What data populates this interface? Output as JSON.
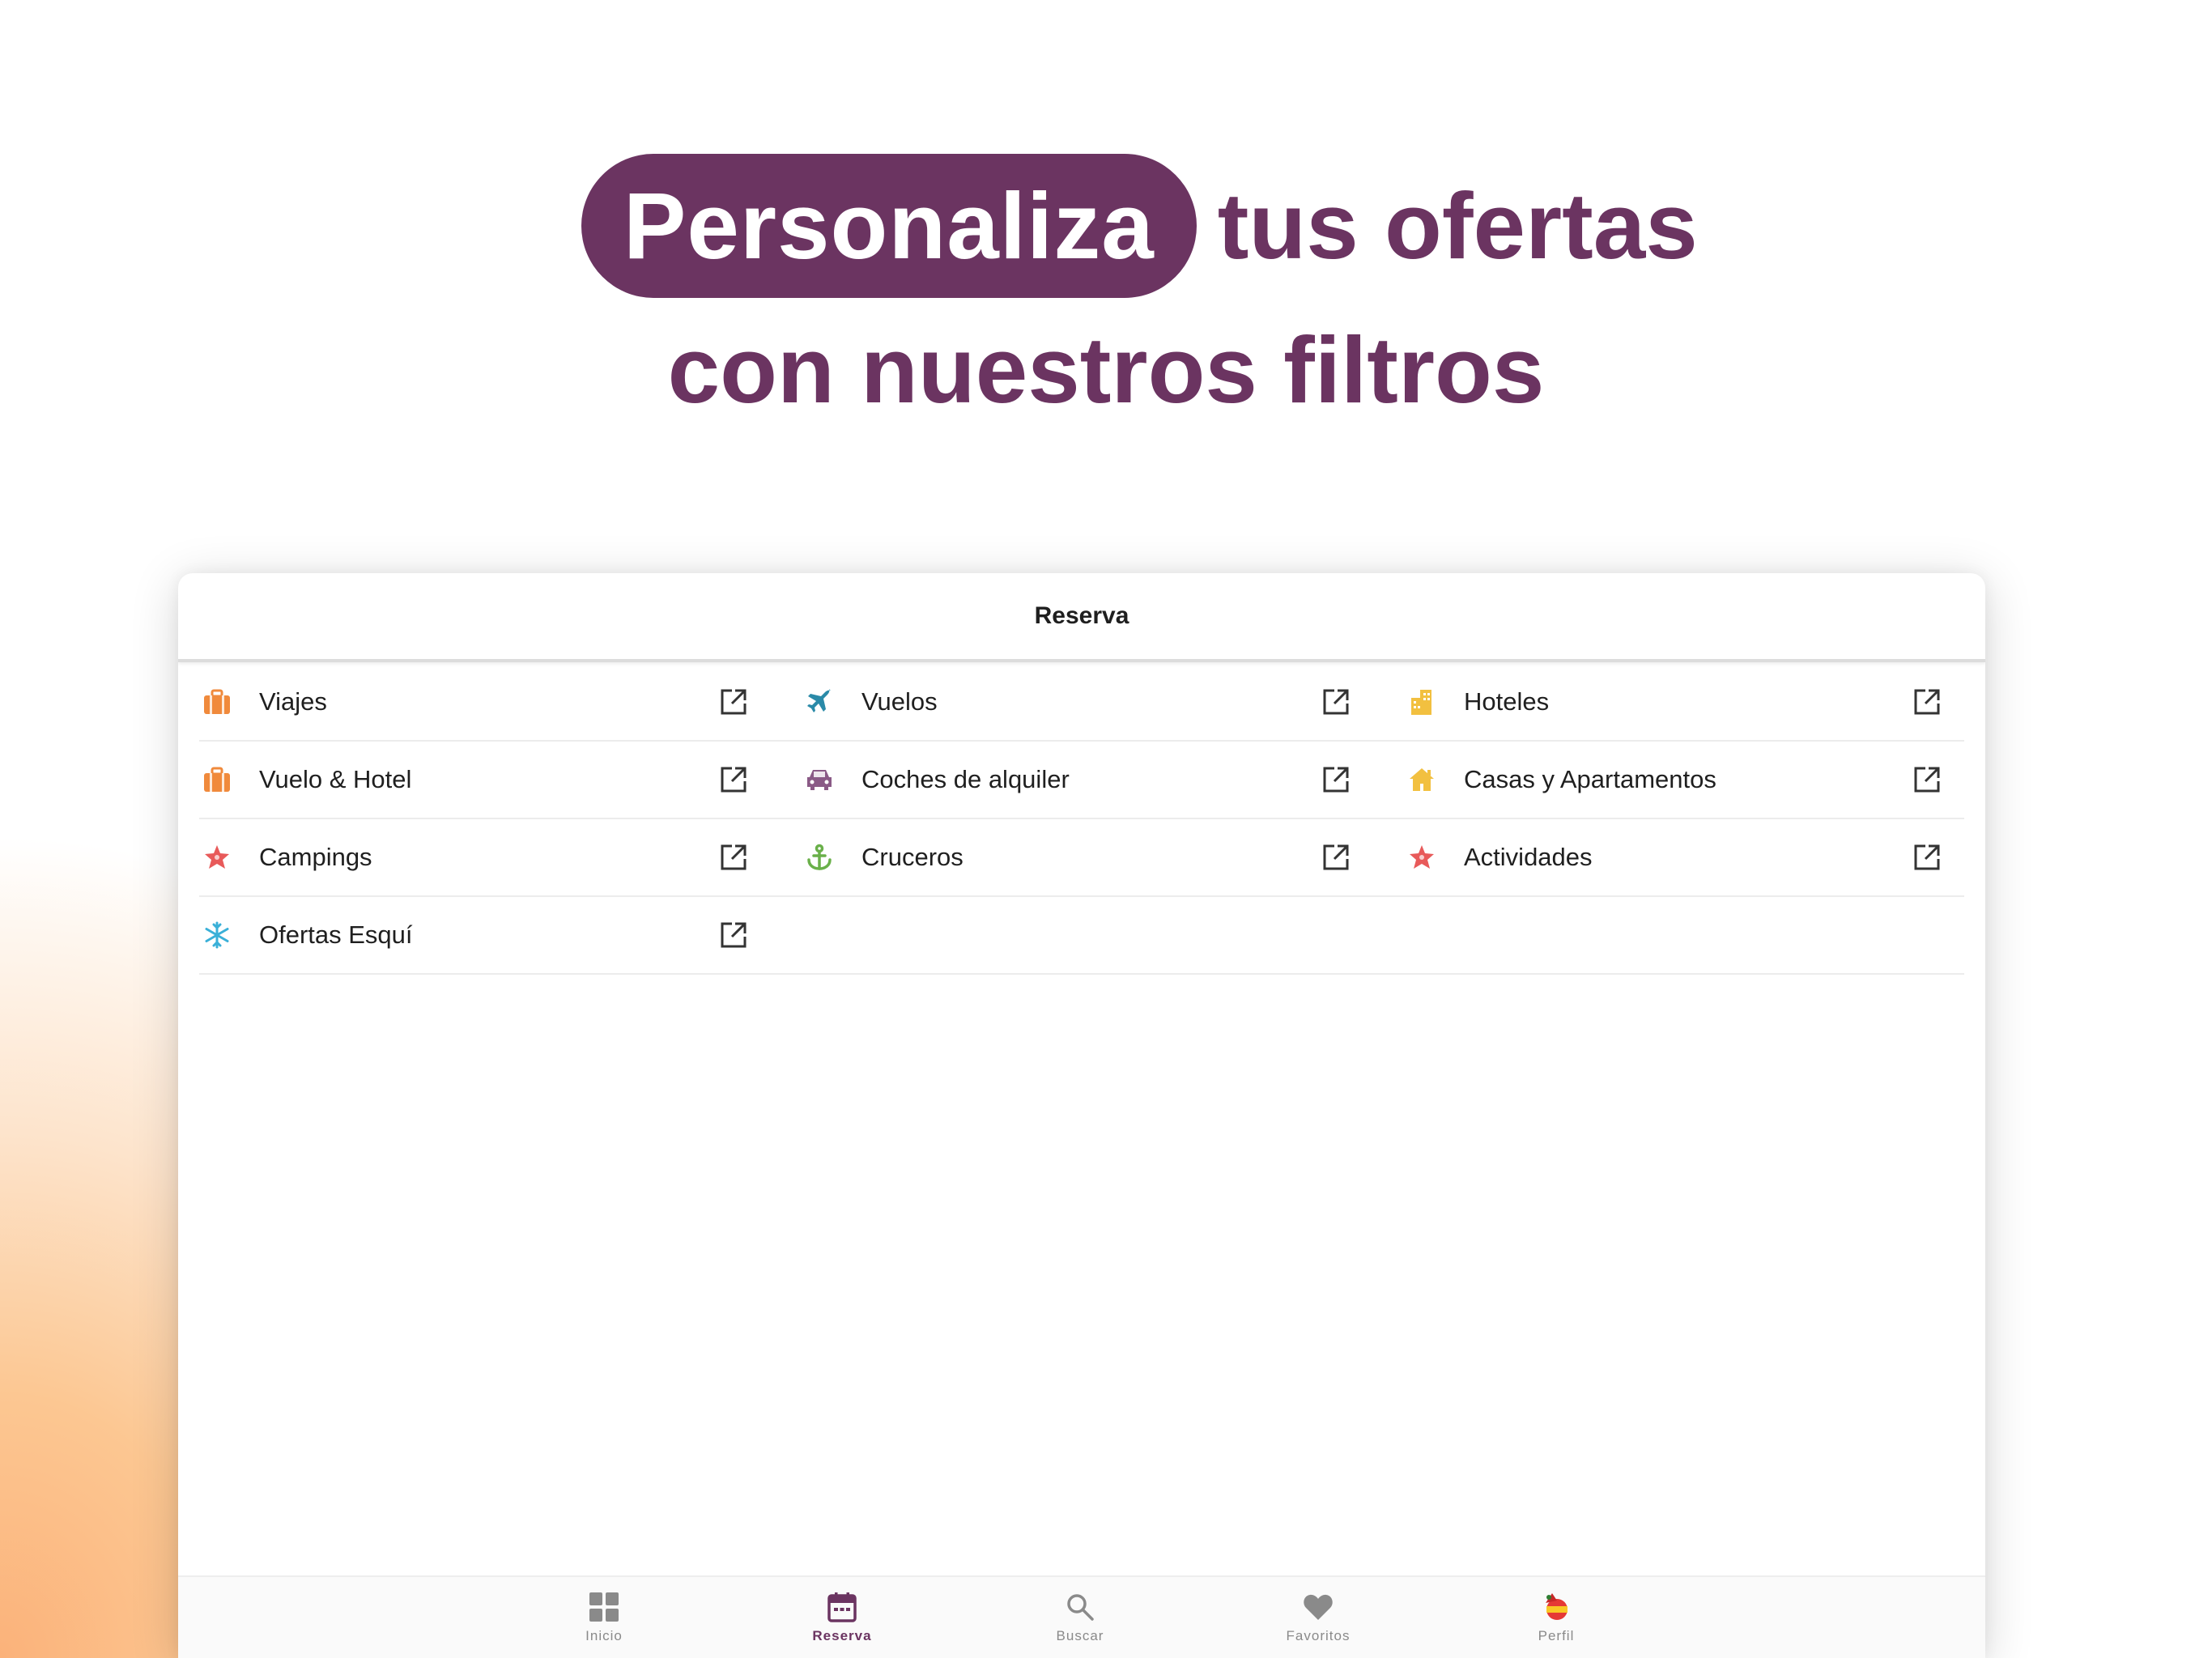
{
  "headline": {
    "highlight": "Personaliza",
    "rest_line1": "tus ofertas",
    "line2": "con nuestros filtros"
  },
  "appbar": {
    "title": "Reserva"
  },
  "menu": [
    {
      "label": "Viajes",
      "icon": "suitcase-icon",
      "color": "#f08a3c"
    },
    {
      "label": "Vuelos",
      "icon": "plane-icon",
      "color": "#2a8aa8"
    },
    {
      "label": "Hoteles",
      "icon": "buildings-icon",
      "color": "#f2c040"
    },
    {
      "label": "Vuelo & Hotel",
      "icon": "suitcase-icon",
      "color": "#f08a3c"
    },
    {
      "label": "Coches de alquiler",
      "icon": "car-icon",
      "color": "#8a5a86"
    },
    {
      "label": "Casas y Apartamentos",
      "icon": "house-icon",
      "color": "#f2c040"
    },
    {
      "label": "Campings",
      "icon": "starfish-icon",
      "color": "#e85a5a"
    },
    {
      "label": "Cruceros",
      "icon": "anchor-icon",
      "color": "#6ab04a"
    },
    {
      "label": "Actividades",
      "icon": "starfish-icon",
      "color": "#e85a5a"
    },
    {
      "label": "Ofertas Esquí",
      "icon": "snowflake-icon",
      "color": "#3ab0d8"
    }
  ],
  "bottom_nav": [
    {
      "label": "Inicio",
      "icon": "grid-icon"
    },
    {
      "label": "Reserva",
      "icon": "calendar-icon",
      "active": true
    },
    {
      "label": "Buscar",
      "icon": "search-icon"
    },
    {
      "label": "Favoritos",
      "icon": "heart-icon"
    },
    {
      "label": "Perfil",
      "icon": "profile-flag-icon"
    }
  ],
  "colors": {
    "brand": "#6b3461",
    "inactive": "#8a8a8a"
  }
}
